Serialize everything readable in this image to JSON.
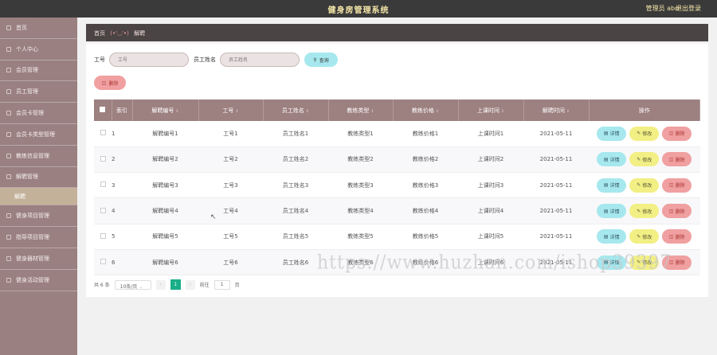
{
  "header": {
    "title": "健身房管理系统",
    "admin": "管理员 abo",
    "logout": "退出登录"
  },
  "sidebar": {
    "items": [
      {
        "label": "首页"
      },
      {
        "label": "个人中心"
      },
      {
        "label": "会员管理"
      },
      {
        "label": "员工管理"
      },
      {
        "label": "会员卡管理"
      },
      {
        "label": "会员卡类型管理"
      },
      {
        "label": "教练信息管理"
      },
      {
        "label": "解聘管理"
      },
      {
        "label": "解聘",
        "sub": true
      },
      {
        "label": "健身项目管理"
      },
      {
        "label": "指导项目管理"
      },
      {
        "label": "健身器材管理"
      },
      {
        "label": "健身活动管理"
      }
    ]
  },
  "breadcrumb": {
    "home": "首页",
    "face": "(•'◡'•)",
    "current": "解聘"
  },
  "search": {
    "label1": "工号",
    "placeholder1": "工号",
    "label2": "员工姓名",
    "placeholder2": "员工姓名",
    "button": "查询"
  },
  "toolbar": {
    "delete": "删除"
  },
  "table": {
    "headers": [
      "索引",
      "解聘编号",
      "工号",
      "员工姓名",
      "教练类型",
      "教练价格",
      "上课时间",
      "解聘时间",
      "操作"
    ],
    "rows": [
      [
        "1",
        "解聘编号1",
        "工号1",
        "员工姓名1",
        "教练类型1",
        "教练价格1",
        "上课时间1",
        "2021-05-11"
      ],
      [
        "2",
        "解聘编号2",
        "工号2",
        "员工姓名2",
        "教练类型2",
        "教练价格2",
        "上课时间2",
        "2021-05-11"
      ],
      [
        "3",
        "解聘编号3",
        "工号3",
        "员工姓名3",
        "教练类型3",
        "教练价格3",
        "上课时间3",
        "2021-05-11"
      ],
      [
        "4",
        "解聘编号4",
        "工号4",
        "员工姓名4",
        "教练类型4",
        "教练价格4",
        "上课时间4",
        "2021-05-11"
      ],
      [
        "5",
        "解聘编号5",
        "工号5",
        "员工姓名5",
        "教练类型5",
        "教练价格5",
        "上课时间5",
        "2021-05-11"
      ],
      [
        "6",
        "解聘编号6",
        "工号6",
        "员工姓名6",
        "教练类型6",
        "教练价格6",
        "上课时间6",
        "2021-05-11"
      ]
    ],
    "actions": {
      "detail": "详情",
      "edit": "修改",
      "delete": "删除"
    }
  },
  "pager": {
    "total": "共 6 条",
    "size": "10条/页",
    "prev": "‹",
    "current": "1",
    "next": "›",
    "goto": "前往",
    "page_input": "1",
    "page_suffix": "页"
  },
  "watermark": "https://www.huzhan.com/ishop39397"
}
